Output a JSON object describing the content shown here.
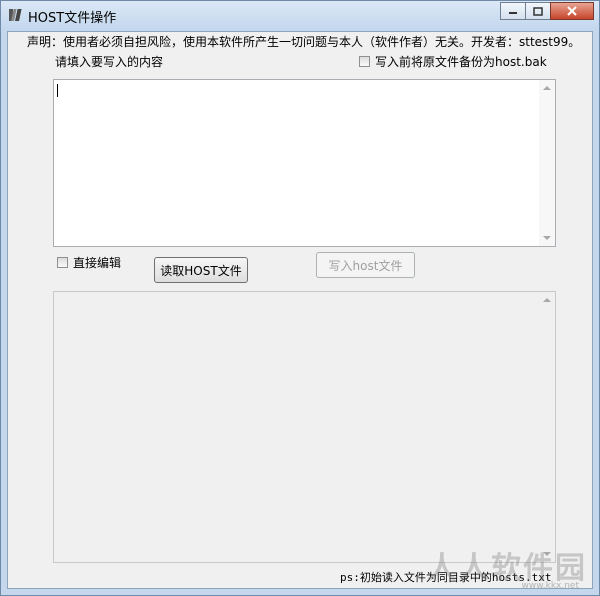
{
  "window": {
    "title": "HOST文件操作",
    "app_icon": "tool-icon",
    "controls": [
      "minimize-icon",
      "maximize-icon",
      "close-icon"
    ]
  },
  "disclaimer": "声明：使用者必须自担风险，使用本软件所产生一切问题与本人（软件作者）无关。开发者：sttest99。",
  "input_prompt": "请填入要写入的内容",
  "backup_checkbox": {
    "label": "写入前将原文件备份为host.bak",
    "checked": false
  },
  "input_area": {
    "value": ""
  },
  "direct_edit_checkbox": {
    "label": "直接编辑",
    "checked": false
  },
  "buttons": {
    "read": "读取HOST文件",
    "write": "写入host文件"
  },
  "output_area": {
    "value": ""
  },
  "footer_note": "ps:初始读入文件为同目录中的hosts.txt",
  "watermark": {
    "text": "人人软件园",
    "url": "www.kkx.net"
  },
  "colors": {
    "title_bar": "#c2d6ed",
    "client_bg": "#f0f0f0",
    "close_button": "#c7452b"
  }
}
